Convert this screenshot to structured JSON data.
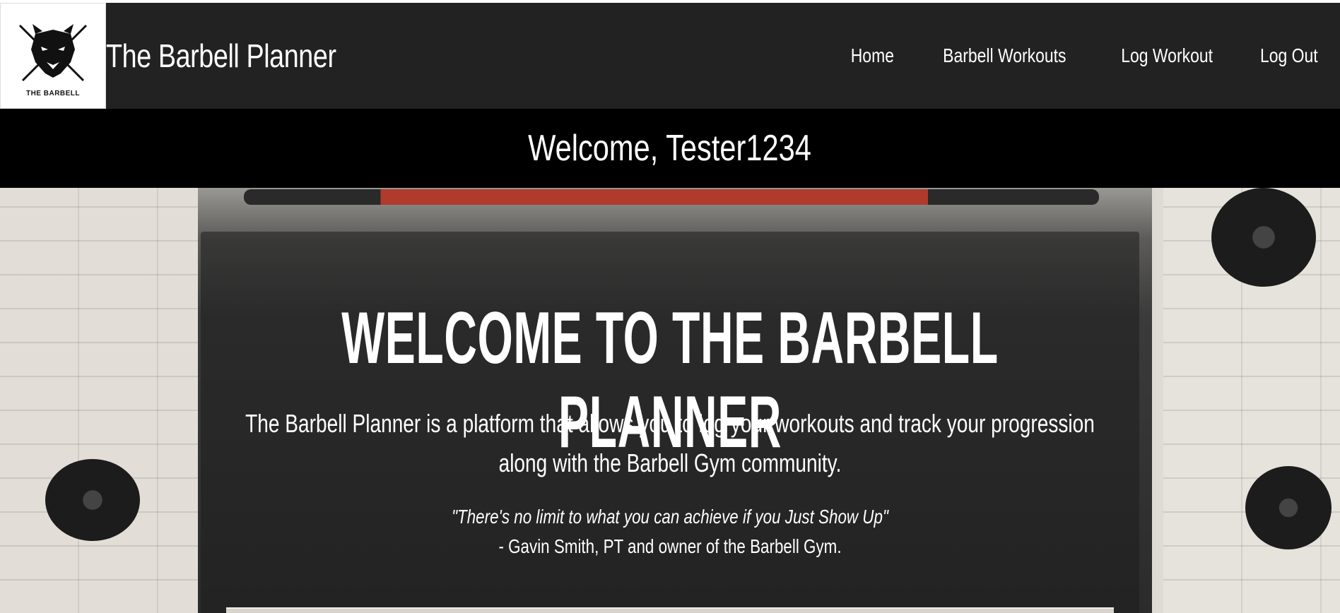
{
  "header": {
    "logo_text": "THE BARBELL",
    "brand": "The Barbell Planner",
    "nav": [
      {
        "label": "Home"
      },
      {
        "label": "Barbell Workouts"
      },
      {
        "label": "Log Workout"
      },
      {
        "label": "Log Out"
      }
    ]
  },
  "welcome": {
    "text": "Welcome, Tester1234"
  },
  "hero": {
    "title": "WELCOME TO THE BARBELL PLANNER",
    "description": "The Barbell Planner is a platform that allows you to log your workouts and track your progression along with the Barbell Gym community.",
    "quote": "\"There's no limit to what you can achieve if you Just Show Up\"",
    "quote_author": "- Gavin Smith, PT and owner of the Barbell Gym."
  }
}
